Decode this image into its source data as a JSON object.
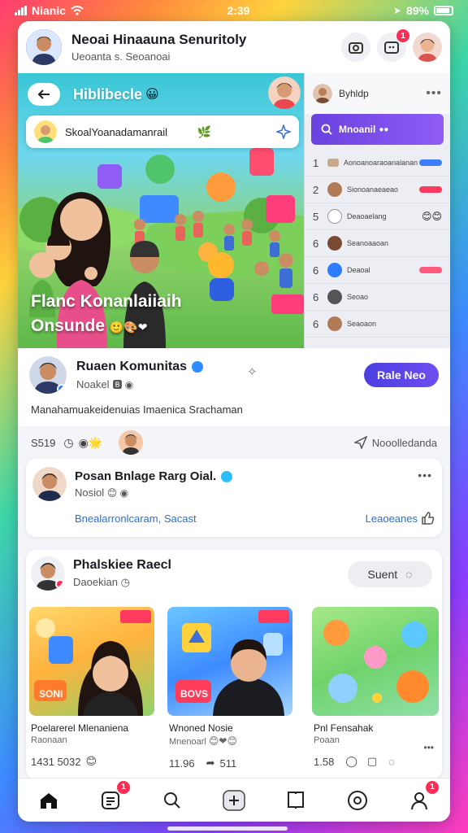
{
  "status_bar": {
    "carrier": "Nianic",
    "time": "2:39",
    "battery": "89%"
  },
  "header": {
    "title": "Neoai Hinaauna Senuritoly",
    "subtitle": "Ueoanta s. Seoanoai"
  },
  "header_badge": "1",
  "hero": {
    "back_label": "Hiblibecle",
    "search_placeholder": "SkoalYoanadamanrail",
    "caption_line1": "Flanc Konanlaiiaih",
    "caption_line2": "Onsunde"
  },
  "side_panel": {
    "user_name": "Byhldp",
    "search_label": "Mnoanil",
    "rows": [
      {
        "num": "1",
        "text": "Aonoanoaraoanalanan",
        "tag": "blue"
      },
      {
        "num": "2",
        "text": "Sionoanaeaeao",
        "tag": "red"
      },
      {
        "num": "5",
        "text": "Deaoaelang",
        "tag": "emoji"
      },
      {
        "num": "6",
        "text": "Seanoaaoan",
        "tag": "none"
      },
      {
        "num": "6",
        "text": "Deaoal",
        "tag": "red"
      },
      {
        "num": "6",
        "text": "Seoao",
        "tag": "none"
      },
      {
        "num": "6",
        "text": "Seaoaon",
        "tag": "none"
      }
    ]
  },
  "profile": {
    "name": "Ruaen Komunitas",
    "sub": "Noakel",
    "follow_label": "Rale Neo",
    "description": "Manahamuakeidenuias Imaenica Srachaman"
  },
  "stats": {
    "count": "S519",
    "action_label": "Nooolledanda"
  },
  "post": {
    "title": "Posan Bnlage Rarg Oial.",
    "sub": "Nosiol",
    "link_text": "Bnealarronlcaram, Sacast",
    "action_text": "Leaoeanes"
  },
  "feed": {
    "title": "Phalskiee Raecl",
    "sub": "Daoekian",
    "button_label": "Suent",
    "tiles": [
      {
        "title": "Poelarerel Mlenaniena",
        "sub": "Raonaan",
        "meta": "1431 5032"
      },
      {
        "title": "Wnoned Nosie",
        "sub": "Mnenoarl",
        "meta": "11.96"
      },
      {
        "title": "Pnl Fensahak",
        "sub": "Poaan",
        "meta": "1.58"
      }
    ],
    "tile2_share_count": "511",
    "tile1_sign": "SONI",
    "tile2_sign": "BOVS"
  },
  "nav_badges": {
    "posts": "1",
    "profile": "1"
  },
  "colors": {
    "accent": "#5a45e8",
    "link": "#2a6fd6",
    "badge": "#ff2d55"
  },
  "icons": [
    "signal-icon",
    "wifi-icon",
    "battery-icon",
    "back-arrow-icon",
    "search-icon",
    "verified-icon",
    "home-icon",
    "posts-icon",
    "plus-icon",
    "bookmark-icon",
    "profile-icon"
  ]
}
